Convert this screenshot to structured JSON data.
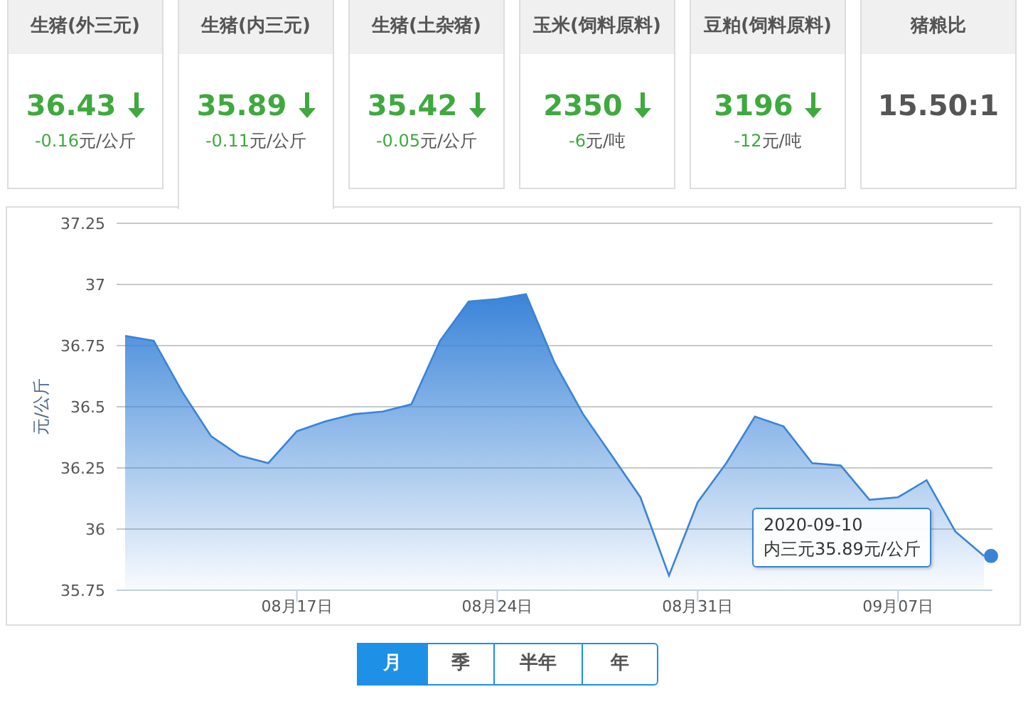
{
  "cards": [
    {
      "title": "生猪(外三元)",
      "value": "36.43",
      "falling": true,
      "change": "-0.16",
      "unit": "元/公斤",
      "selected": false
    },
    {
      "title": "生猪(内三元)",
      "value": "35.89",
      "falling": true,
      "change": "-0.11",
      "unit": "元/公斤",
      "selected": true
    },
    {
      "title": "生猪(土杂猪)",
      "value": "35.42",
      "falling": true,
      "change": "-0.05",
      "unit": "元/公斤",
      "selected": false
    },
    {
      "title": "玉米(饲料原料)",
      "value": "2350",
      "falling": true,
      "change": "-6",
      "unit": "元/吨",
      "selected": false
    },
    {
      "title": "豆粕(饲料原料)",
      "value": "3196",
      "falling": true,
      "change": "-12",
      "unit": "元/吨",
      "selected": false
    },
    {
      "title": "猪粮比",
      "value": "15.50:1",
      "selected": false
    }
  ],
  "chart": {
    "chart_data": {
      "type": "area",
      "ylabel": "元/公斤",
      "categories": [
        null,
        null,
        null,
        null,
        null,
        null,
        "08月17日",
        null,
        null,
        null,
        null,
        null,
        null,
        "08月24日",
        null,
        null,
        null,
        null,
        null,
        null,
        "08月31日",
        null,
        null,
        null,
        null,
        null,
        null,
        "09月07日",
        null,
        null,
        null
      ],
      "series": [
        {
          "color": "#3a84d8",
          "values": [
            36.79,
            36.77,
            36.56,
            36.38,
            36.3,
            36.27,
            36.4,
            36.44,
            36.47,
            36.48,
            36.51,
            36.77,
            36.93,
            36.94,
            36.96,
            36.68,
            36.47,
            36.3,
            36.13,
            35.81,
            36.11,
            36.27,
            36.46,
            36.42,
            36.27,
            36.26,
            36.12,
            36.13,
            36.2,
            35.99,
            35.89
          ]
        }
      ],
      "ylim": [
        35.75,
        37.25
      ],
      "grid": true,
      "yticks": [
        35.75,
        36,
        36.25,
        36.5,
        36.75,
        37,
        37.25
      ]
    },
    "tooltip": {
      "date": "2020-09-10",
      "text": "内三元35.89元/公斤"
    }
  },
  "ranges": [
    {
      "label": "月",
      "selected": true
    },
    {
      "label": "季",
      "selected": false
    },
    {
      "label": "半年",
      "selected": false
    },
    {
      "label": "年",
      "selected": false
    }
  ]
}
